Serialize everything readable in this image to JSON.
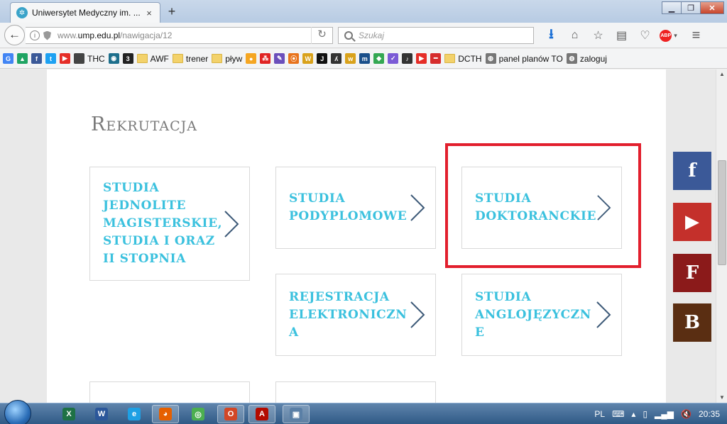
{
  "browser": {
    "tab_title": "Uniwersytet Medyczny im. ...",
    "tab_close": "×",
    "new_tab": "+",
    "back": "←",
    "url_prefix": "www.",
    "url_domain": "ump.edu.pl",
    "url_path": "/nawigacja/12",
    "search_placeholder": "Szukaj",
    "reload": "↻",
    "window_buttons": {
      "minimize": "▁",
      "maximize": "❐",
      "close": "✕"
    },
    "toolbar_icons": [
      "download-icon",
      "home-icon",
      "star-icon",
      "reading-list-icon",
      "pocket-icon",
      "adblock-icon",
      "menu-icon"
    ],
    "adblock_label": "ABP"
  },
  "bookmarks": [
    {
      "icon": "google-icon",
      "label": "",
      "color": "#4285f4",
      "glyph": "G"
    },
    {
      "icon": "drive-icon",
      "label": "",
      "color": "#1fa463",
      "glyph": "▲"
    },
    {
      "icon": "facebook-icon",
      "label": "",
      "color": "#3b5998",
      "glyph": "f"
    },
    {
      "icon": "twitter-icon",
      "label": "",
      "color": "#1da1f2",
      "glyph": "t"
    },
    {
      "icon": "youtube-icon",
      "label": "",
      "color": "#e52d27",
      "glyph": "▶"
    },
    {
      "icon": "thc-icon",
      "label": "THC",
      "color": "#444444",
      "glyph": ""
    },
    {
      "icon": "circle-icon",
      "label": "",
      "color": "#1d6f8c",
      "glyph": "◉"
    },
    {
      "icon": "b3-icon",
      "label": "",
      "color": "#222222",
      "glyph": "3"
    },
    {
      "icon": "folder-icon",
      "label": "AWF",
      "color": "",
      "glyph": ""
    },
    {
      "icon": "folder-icon",
      "label": "trener",
      "color": "",
      "glyph": ""
    },
    {
      "icon": "folder-icon",
      "label": "pływ",
      "color": "",
      "glyph": ""
    },
    {
      "icon": "orange-icon",
      "label": "",
      "color": "#f5a623",
      "glyph": "●"
    },
    {
      "icon": "grid-icon",
      "label": "",
      "color": "#e02424",
      "glyph": "⁂"
    },
    {
      "icon": "paint-icon",
      "label": "",
      "color": "#6b4fbb",
      "glyph": "✎"
    },
    {
      "icon": "power-icon",
      "label": "",
      "color": "#e8731c",
      "glyph": "⦿"
    },
    {
      "icon": "w-icon",
      "label": "",
      "color": "#d9a21b",
      "glyph": "W"
    },
    {
      "icon": "j-icon",
      "label": "",
      "color": "#111111",
      "glyph": "J"
    },
    {
      "icon": "figure-icon",
      "label": "",
      "color": "#333333",
      "glyph": "ʎ"
    },
    {
      "icon": "w2-icon",
      "label": "",
      "color": "#d9a21b",
      "glyph": "w"
    },
    {
      "icon": "m-icon",
      "label": "",
      "color": "#1a4f8a",
      "glyph": "m"
    },
    {
      "icon": "maps-icon",
      "label": "",
      "color": "#34a853",
      "glyph": "◆"
    },
    {
      "icon": "check-icon",
      "label": "",
      "color": "#7b5bd6",
      "glyph": "✓"
    },
    {
      "icon": "music-icon",
      "label": "",
      "color": "#333333",
      "glyph": "♪"
    },
    {
      "icon": "youtube2-icon",
      "label": "",
      "color": "#e52d27",
      "glyph": "▶"
    },
    {
      "icon": "block-icon",
      "label": "",
      "color": "#d62d2d",
      "glyph": "━"
    },
    {
      "icon": "folder-icon",
      "label": "DCTH",
      "color": "",
      "glyph": ""
    },
    {
      "icon": "globe-icon",
      "label": "panel planów TO",
      "color": "#777777",
      "glyph": "◍"
    },
    {
      "icon": "globe-icon",
      "label": "zaloguj",
      "color": "#777777",
      "glyph": "◍"
    }
  ],
  "page": {
    "heading": "Rekrutacja",
    "cards": [
      {
        "id": "jednolite",
        "title": "STUDIA\nJEDNOLITE\nMAGISTERSKIE,\nSTUDIA I ORAZ\nII STOPNIA"
      },
      {
        "id": "podyplomowe",
        "title": "STUDIA\nPODYPLOMOWE"
      },
      {
        "id": "doktoranckie",
        "title": "STUDIA\nDOKTORANCKIE"
      },
      {
        "id": "rejestracja",
        "title": "REJESTRACJA\nELEKTRONICZN\nA"
      },
      {
        "id": "anglojezyczne",
        "title": "STUDIA\nANGLOJĘZYCZN\nE"
      }
    ],
    "accent_color": "#3bc1de",
    "highlight_color": "#e21f2d"
  },
  "social": [
    {
      "icon": "facebook-icon",
      "glyph": "f",
      "color": "#3b5998"
    },
    {
      "icon": "youtube-icon",
      "glyph": "▶",
      "color": "#c4302b"
    },
    {
      "icon": "f-icon",
      "glyph": "F",
      "color": "#8b1a1a"
    },
    {
      "icon": "b-icon",
      "glyph": "B",
      "color": "#5a2e12"
    }
  ],
  "taskbar": {
    "apps": [
      "excel-icon",
      "word-icon",
      "ie-icon",
      "firefox-icon",
      "chrome-icon",
      "office-icon",
      "acrobat-icon",
      "window-icon"
    ],
    "lang": "PL",
    "clock": "20:35"
  }
}
